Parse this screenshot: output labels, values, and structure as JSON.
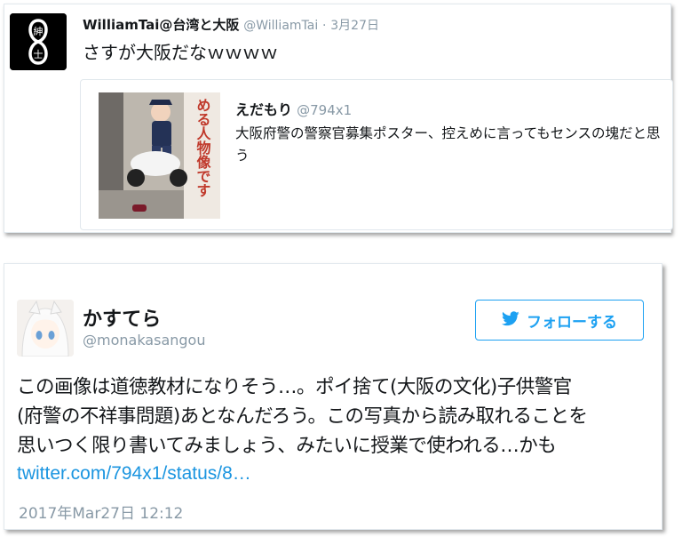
{
  "tweet1": {
    "author_name": "WilliamTai@台湾と大阪",
    "author_handle": "@WilliamTai",
    "separator": "·",
    "date": "3月27日",
    "text": "さすが大阪だなｗｗｗｗ",
    "avatar_icon": "infinity-crest-icon",
    "avatar_glyphs": [
      "紳",
      "士"
    ],
    "quote": {
      "author_name": "えだもり",
      "author_handle": "@794x1",
      "text": "大阪府警の警察官募集ポスター、控えめに言ってもセンスの塊だと思う",
      "image_caption": "める人物像です"
    }
  },
  "tweet2": {
    "author_name": "かすてら",
    "author_handle": "@monakasangou",
    "follow_label": "フォローする",
    "follow_icon": "twitter-bird-icon",
    "text_lines": [
      "この画像は道徳教材になりそう…。ポイ捨て(大阪の文化)子供警官",
      "(府警の不祥事問題)あとなんだろう。この写真から読み取れることを",
      "思いつく限り書いてみましょう、みたいに授業で使われる…かも"
    ],
    "link": "twitter.com/794x1/status/8…",
    "timestamp": "2017年Mar27日 12:12"
  },
  "colors": {
    "accent": "#1da1f2",
    "link": "#1b95e0",
    "muted": "#8899a6",
    "border": "#e1e8ed"
  }
}
